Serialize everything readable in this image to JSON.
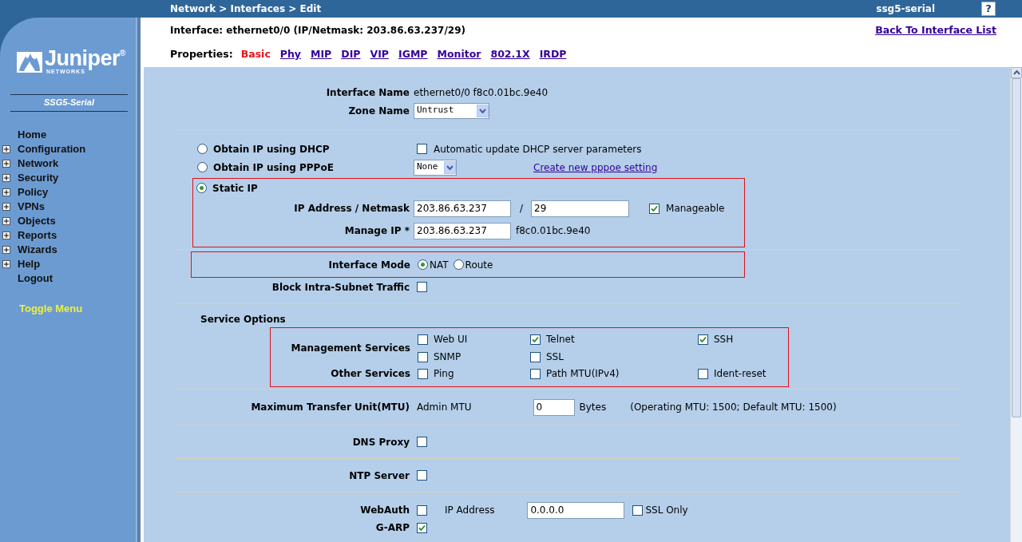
{
  "header": {
    "breadcrumb": "Network > Interfaces > Edit",
    "device": "ssg5-serial",
    "help": "?"
  },
  "sidebar": {
    "logo": {
      "name": "Juniper$^{®}$",
      "sub": "NETWORKS"
    },
    "model": "SSG5-Serial",
    "menu": [
      {
        "label": "Home",
        "expandable": false
      },
      {
        "label": "Configuration",
        "expandable": true
      },
      {
        "label": "Network",
        "expandable": true
      },
      {
        "label": "Security",
        "expandable": true
      },
      {
        "label": "Policy",
        "expandable": true
      },
      {
        "label": "VPNs",
        "expandable": true
      },
      {
        "label": "Objects",
        "expandable": true
      },
      {
        "label": "Reports",
        "expandable": true
      },
      {
        "label": "Wizards",
        "expandable": true
      },
      {
        "label": "Help",
        "expandable": true
      },
      {
        "label": "Logout",
        "expandable": false
      }
    ],
    "toggle": "Toggle Menu"
  },
  "interface_title": "Interface: ethernet0/0 (IP/Netmask: 203.86.63.237/29)",
  "back_link": "Back To Interface List",
  "properties": {
    "label": "Properties:",
    "tabs": [
      {
        "label": "Basic",
        "selected": true
      },
      {
        "label": "Phy",
        "selected": false
      },
      {
        "label": "MIP",
        "selected": false
      },
      {
        "label": "DIP",
        "selected": false
      },
      {
        "label": "VIP",
        "selected": false
      },
      {
        "label": "IGMP",
        "selected": false
      },
      {
        "label": "Monitor",
        "selected": false
      },
      {
        "label": "802.1X",
        "selected": false
      },
      {
        "label": "IRDP",
        "selected": false
      }
    ]
  },
  "form": {
    "interface_name": {
      "label": "Interface Name",
      "value": "ethernet0/0 f8c0.01bc.9e40"
    },
    "zone_name": {
      "label": "Zone Name",
      "value": "Untrust"
    },
    "dhcp": {
      "label": "Obtain IP using DHCP",
      "selected": false,
      "option": {
        "label": "Automatic update DHCP server parameters",
        "checked": false
      }
    },
    "pppoe": {
      "label": "Obtain IP using PPPoE",
      "selected": false,
      "select_value": "None",
      "link": "Create new pppoe setting"
    },
    "static": {
      "label": "Static IP",
      "selected": true
    },
    "ip_address": {
      "label": "IP Address / Netmask",
      "ip": "203.86.63.237",
      "separator": "/",
      "mask": "29",
      "manageable": {
        "label": "Manageable",
        "checked": true
      }
    },
    "manage_ip": {
      "label": "Manage IP *",
      "value": "203.86.63.237",
      "mac": "f8c0.01bc.9e40"
    },
    "interface_mode": {
      "label": "Interface Mode",
      "options": [
        {
          "label": "NAT",
          "selected": true
        },
        {
          "label": "Route",
          "selected": false
        }
      ]
    },
    "block_intra_subnet": {
      "label": "Block Intra-Subnet Traffic",
      "checked": false
    },
    "service_options": {
      "title": "Service Options",
      "groups": [
        {
          "label": "Management Services",
          "rows": [
            [
              {
                "label": "Web UI",
                "checked": false
              },
              {
                "label": "Telnet",
                "checked": true
              },
              {
                "label": "SSH",
                "checked": true
              }
            ],
            [
              {
                "label": "SNMP",
                "checked": false
              },
              {
                "label": "SSL",
                "checked": false
              }
            ]
          ]
        },
        {
          "label": "Other Services",
          "rows": [
            [
              {
                "label": "Ping",
                "checked": false
              },
              {
                "label": "Path MTU(IPv4)",
                "checked": false
              },
              {
                "label": "Ident-reset",
                "checked": false
              }
            ]
          ]
        }
      ]
    },
    "mtu": {
      "label": "Maximum Transfer Unit(MTU)",
      "field_label": "Admin MTU",
      "value": "0",
      "unit": "Bytes",
      "note": "(Operating MTU: 1500; Default MTU: 1500)"
    },
    "dns_proxy": {
      "label": "DNS Proxy",
      "checked": false
    },
    "ntp_server": {
      "label": "NTP Server",
      "checked": false
    },
    "webauth": {
      "label": "WebAuth",
      "checked": false,
      "ip_label": "IP Address",
      "ip": "0.0.0.0",
      "ssl_only": {
        "label": "SSL Only",
        "checked": false
      }
    },
    "g_arp": {
      "label": "G-ARP",
      "checked": true
    }
  }
}
